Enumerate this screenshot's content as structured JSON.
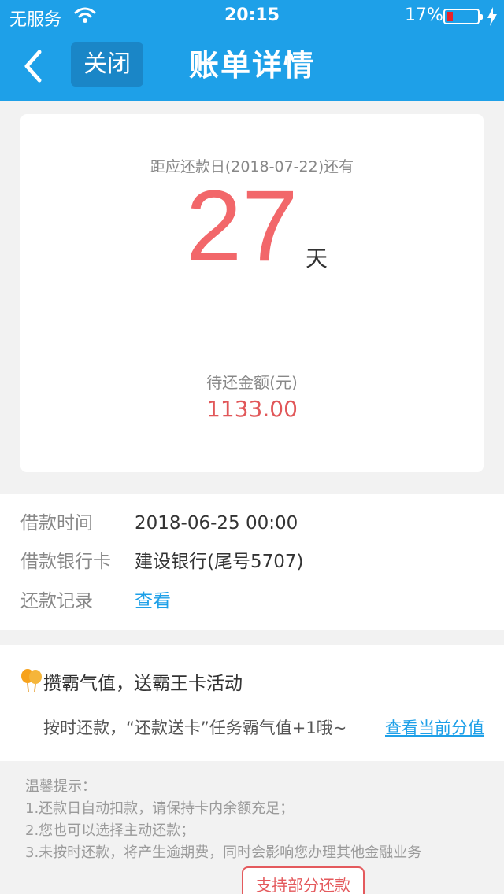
{
  "status_bar": {
    "carrier": "无服务",
    "time": "20:15",
    "battery": "17%",
    "icons": [
      "wifi-icon",
      "battery-icon",
      "charging-bolt-icon"
    ]
  },
  "nav": {
    "back_icon": "chevron-left-icon",
    "close_label": "关闭",
    "title": "账单详情"
  },
  "due": {
    "caption": "距应还款日(2018-07-22)还有",
    "days": "27",
    "unit": "天"
  },
  "amount": {
    "label": "待还金额(元)",
    "value": "1133.00"
  },
  "info": {
    "rows": [
      {
        "label": "借款时间",
        "value": "2018-06-25 00:00"
      },
      {
        "label": "借款银行卡",
        "value": "建设银行(尾号5707)"
      },
      {
        "label": "还款记录",
        "value": "查看"
      }
    ]
  },
  "promo": {
    "icon": "balloon-icon",
    "title": "攒霸气值，送霸王卡活动",
    "text": "按时还款，“还款送卡”任务霸气值+1哦~",
    "link": "查看当前分值"
  },
  "tips": {
    "title": "温馨提示：",
    "lines": [
      "1.还款日自动扣款，请保持卡内余额充足；",
      "2.您也可以选择主动还款；",
      "3.未按时还款，将产生逾期费，同时会影响您办理其他金融业务"
    ]
  },
  "partial_repay_button": "支持部分还款",
  "colors": {
    "header": "#1ea0e8",
    "accent_red": "#f2676a",
    "link_blue": "#1ea0e8"
  }
}
